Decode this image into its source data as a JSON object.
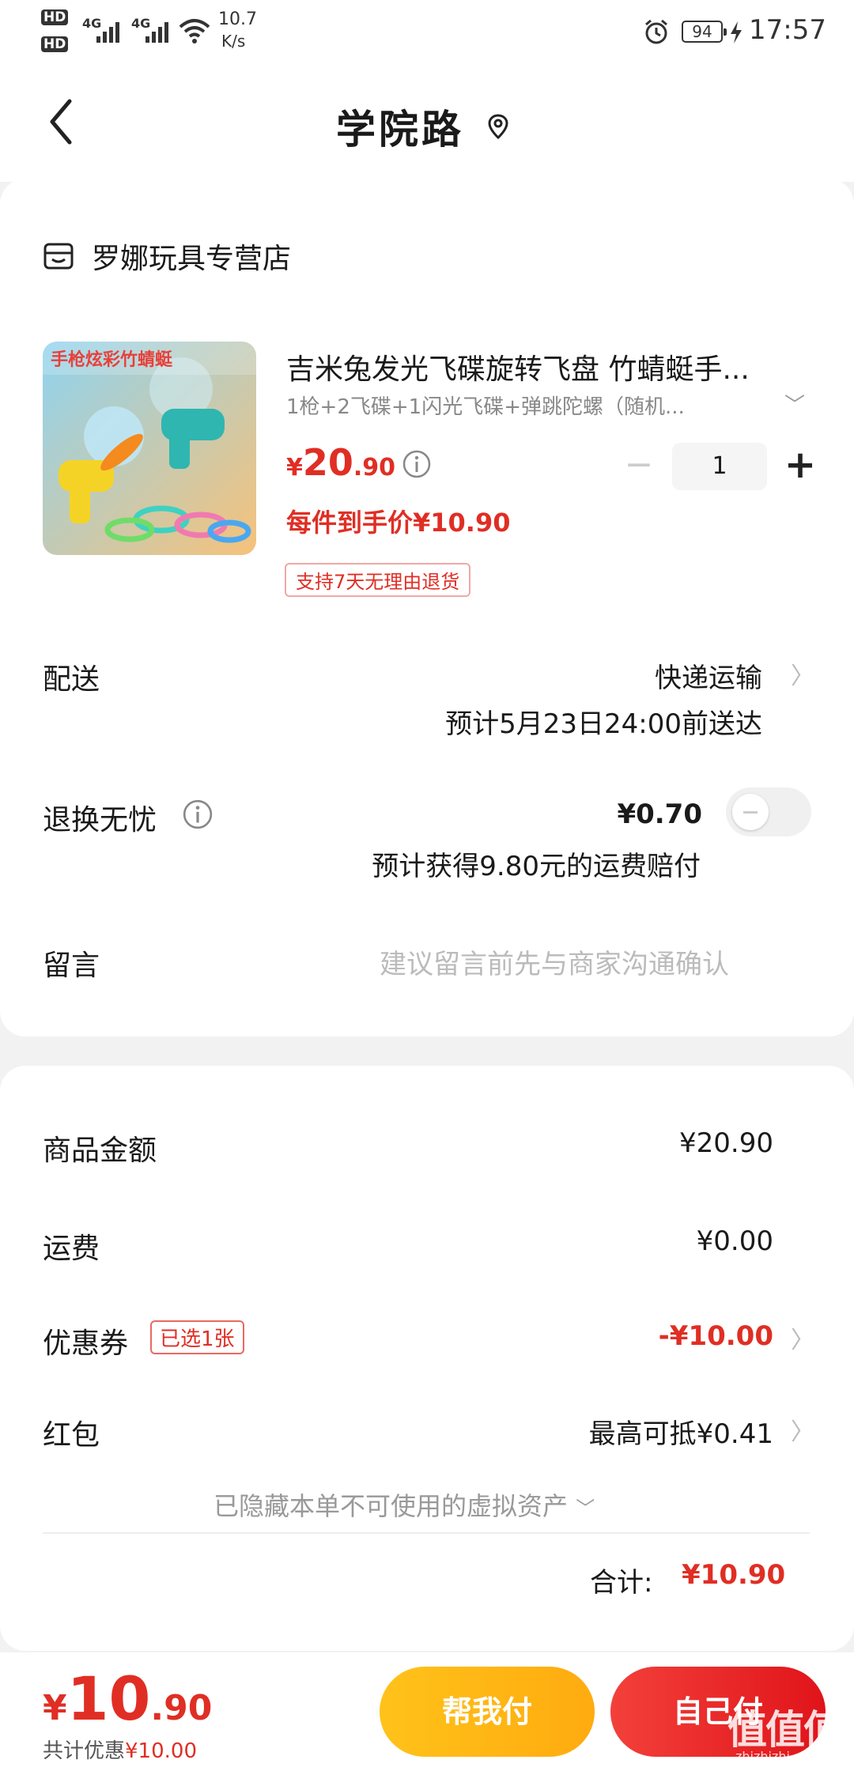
{
  "status_bar": {
    "hd1": "HD",
    "hd2": "HD",
    "net1": "4G",
    "net2": "4G",
    "speed": "10.7",
    "speed_unit": "K/s",
    "battery": "94",
    "time": "17:57"
  },
  "header": {
    "title": "学院路"
  },
  "shop": {
    "name": "罗娜玩具专营店"
  },
  "product": {
    "image_caption": "手枪炫彩竹蜻蜓",
    "title": "吉米兔发光飞碟旋转飞盘 竹蜻蜓手...",
    "spec": "1枪+2飞碟+1闪光飞碟+弹跳陀螺（随机...",
    "price_symbol": "¥",
    "price_int": "20",
    "price_dec": ".90",
    "quantity": "1",
    "final_price": "每件到手价¥10.90",
    "return_tag": "支持7天无理由退货"
  },
  "delivery": {
    "label": "配送",
    "method": "快递运输",
    "eta": "预计5月23日24:00前送达"
  },
  "return_insurance": {
    "label": "退换无忧",
    "price": "¥0.70",
    "desc": "预计获得9.80元的运费赔付",
    "enabled": false
  },
  "remark": {
    "label": "留言",
    "placeholder": "建议留言前先与商家沟通确认"
  },
  "summary": {
    "goods_label": "商品金额",
    "goods_value": "¥20.90",
    "shipping_label": "运费",
    "shipping_value": "¥0.00",
    "coupon_label": "优惠券",
    "coupon_tag": "已选1张",
    "coupon_value": "-¥10.00",
    "redpacket_label": "红包",
    "redpacket_value": "最高可抵¥0.41",
    "hidden_assets": "已隐藏本单不可使用的虚拟资产",
    "total_label": "合计:",
    "total_value": "¥10.90"
  },
  "bottom_bar": {
    "symbol": "¥",
    "pay_int": "10",
    "pay_dec": ".90",
    "saved_label": "共计优惠",
    "saved_amount": "¥10.00",
    "help_pay": "帮我付",
    "self_pay": "自己付"
  },
  "watermark": {
    "text": "值值值",
    "sub": "zhizhizhi.com"
  },
  "colors": {
    "accent": "#e02e24",
    "help_btn": "#ffb70f",
    "self_btn": "#e8221f"
  }
}
